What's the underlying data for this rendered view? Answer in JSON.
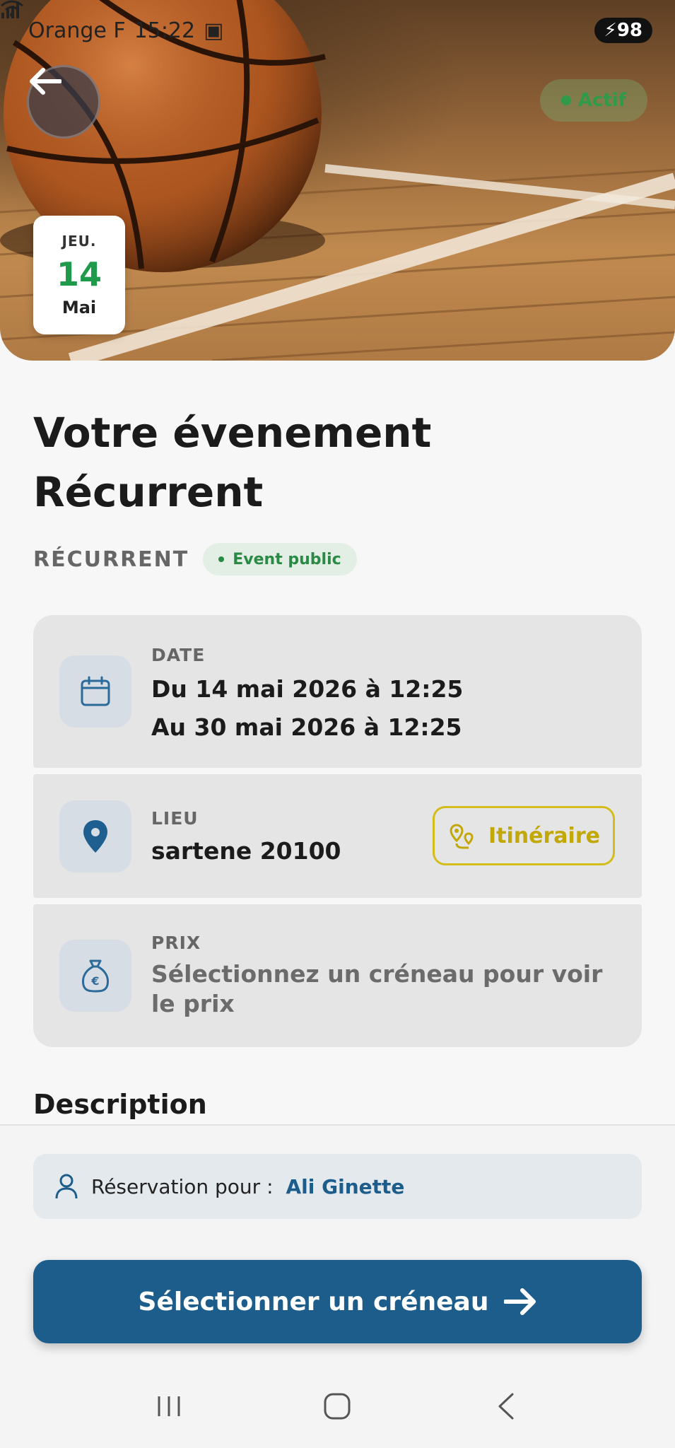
{
  "status_bar": {
    "carrier": "Orange F",
    "time": "15:22",
    "battery": "98"
  },
  "hero": {
    "status": "Actif",
    "date_badge": {
      "weekday": "JEU.",
      "day": "14",
      "month": "Mai"
    }
  },
  "event": {
    "title_line1": "Votre évenement",
    "title_line2": "Récurrent",
    "type": "RÉCURRENT",
    "visibility": "Event public"
  },
  "cards": {
    "date": {
      "label": "DATE",
      "line1": "Du 14 mai 2026 à 12:25",
      "line2": "Au 30 mai 2026 à 12:25"
    },
    "lieu": {
      "label": "LIEU",
      "value": "sartene 20100",
      "itinerary_label": "Itinéraire"
    },
    "prix": {
      "label": "PRIX",
      "value": "Sélectionnez un créneau pour voir le prix"
    }
  },
  "description": {
    "title": "Description"
  },
  "bottom": {
    "reservation_prefix": "Réservation pour :",
    "reservation_name": "Ali Ginette",
    "cta_label": "Sélectionner un créneau"
  },
  "colors": {
    "primary": "#1d5d8c",
    "success": "#2a8a45",
    "itinerary": "#c2a806"
  }
}
